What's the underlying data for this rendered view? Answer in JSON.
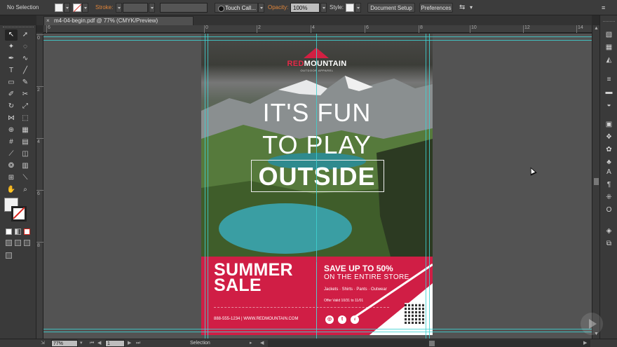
{
  "control_bar": {
    "selection": "No Selection",
    "stroke_label": "Stroke:",
    "brush": "Touch Call...",
    "opacity_label": "Opacity:",
    "opacity_value": "100%",
    "style_label": "Style:",
    "document_setup": "Document Setup",
    "preferences": "Preferences"
  },
  "document": {
    "tab_title": "m4-04-begin.pdf @ 77% (CMYK/Preview)",
    "close_glyph": "×"
  },
  "rulers": {
    "h_labels": [
      "6",
      "0",
      "2",
      "4",
      "6",
      "8",
      "10",
      "12",
      "14"
    ],
    "v_labels": [
      "0",
      "2",
      "4",
      "6",
      "8"
    ]
  },
  "artwork": {
    "brand_red": "RED",
    "brand_white": "MOUNTAIN",
    "brand_sub": "OUTDOOR APPAREL",
    "headline_1": "IT'S FUN",
    "headline_2": "TO PLAY",
    "headline_3": "OUTSIDE",
    "summer": "SUMMER",
    "sale": "SALE",
    "save_line": "SAVE UP TO 50%",
    "store_line": "ON THE ENTIRE STORE",
    "categories": "Jackets · Shirts · Pants · Outwear",
    "offer": "Offer Valid 10/31 to 11/01",
    "contact": "888-555-1234  |  WWW.REDMOUNTAIN.COM",
    "social": [
      "◎",
      "t",
      "f"
    ],
    "colors": {
      "brand_red": "#d01e45",
      "guide": "#3fd1d1"
    }
  },
  "status_bar": {
    "zoom": "77%",
    "page": "1",
    "mode": "Selection"
  },
  "tools_icons": [
    "selection-icon",
    "direct-selection-icon",
    "magic-wand-icon",
    "lasso-icon",
    "pen-icon",
    "curvature-icon",
    "type-icon",
    "line-icon",
    "rectangle-icon",
    "paintbrush-icon",
    "shaper-icon",
    "eraser-icon",
    "rotate-icon",
    "scale-icon",
    "width-icon",
    "free-transform-icon",
    "shape-builder-icon",
    "perspective-icon",
    "mesh-icon",
    "gradient-icon",
    "eyedropper-icon",
    "blend-icon",
    "symbol-sprayer-icon",
    "column-graph-icon",
    "artboard-icon",
    "slice-icon",
    "hand-icon",
    "zoom-icon"
  ],
  "dock_icons": [
    "color-panel-icon",
    "color-guide-icon",
    "swatches-icon",
    "stroke-icon",
    "gradient-panel-icon",
    "transparency-icon",
    "appearance-icon",
    "graphic-styles-icon",
    "brushes-icon",
    "symbols-icon",
    "character-icon",
    "paragraph-icon",
    "glyphs-icon",
    "opentype-icon",
    "layers-icon",
    "artboards-panel-icon"
  ]
}
